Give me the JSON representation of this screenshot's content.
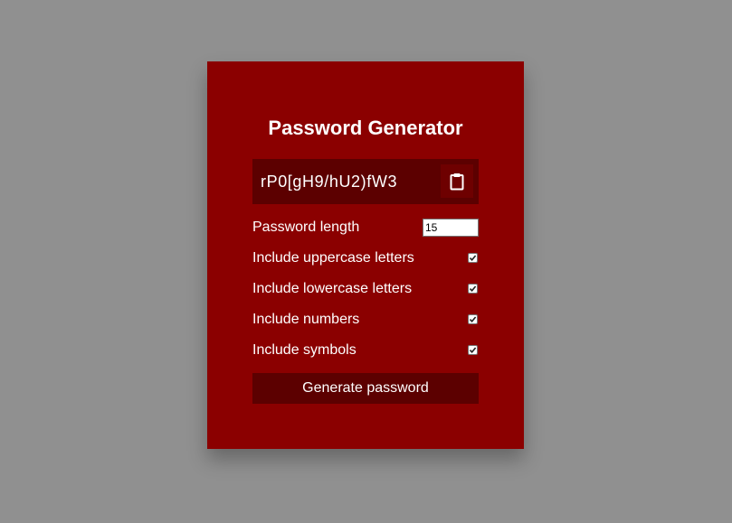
{
  "app": {
    "title": "Password Generator"
  },
  "result": {
    "password": "rP0[gH9/hU2)fW3",
    "copy_icon": "clipboard-icon"
  },
  "settings": {
    "length": {
      "label": "Password length",
      "value": "15"
    },
    "options": [
      {
        "label": "Include uppercase letters",
        "checked": true
      },
      {
        "label": "Include lowercase letters",
        "checked": true
      },
      {
        "label": "Include numbers",
        "checked": true
      },
      {
        "label": "Include symbols",
        "checked": true
      }
    ]
  },
  "actions": {
    "generate_label": "Generate password"
  },
  "colors": {
    "background": "#909090",
    "card": "#8b0000",
    "result_box": "#5c0000",
    "button": "#5c0000",
    "text": "#ffffff"
  }
}
